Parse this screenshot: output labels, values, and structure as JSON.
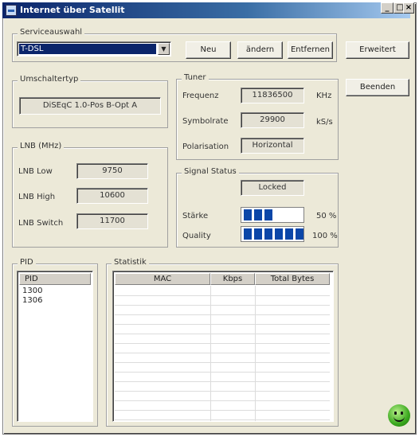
{
  "window": {
    "title": "Internet über Satellit",
    "min_label": "_",
    "max_label": "□",
    "close_label": "×"
  },
  "service": {
    "legend": "Serviceauswahl",
    "selected": "T-DSL",
    "new_label": "Neu",
    "change_label": "ändern",
    "remove_label": "Entfernen"
  },
  "buttons": {
    "advanced_label": "Erweitert",
    "exit_label": "Beenden"
  },
  "switch": {
    "legend": "Umschaltertyp",
    "value": "DiSEqC 1.0-Pos B-Opt A"
  },
  "tuner": {
    "legend": "Tuner",
    "frequency_label": "Frequenz",
    "frequency_value": "11836500",
    "frequency_unit": "KHz",
    "symbolrate_label": "Symbolrate",
    "symbolrate_value": "29900",
    "symbolrate_unit": "kS/s",
    "polarisation_label": "Polarisation",
    "polarisation_value": "Horizontal"
  },
  "lnb": {
    "legend": "LNB (MHz)",
    "low_label": "LNB Low",
    "low_value": "9750",
    "high_label": "LNB High",
    "high_value": "10600",
    "switch_label": "LNB Switch",
    "switch_value": "11700"
  },
  "signal": {
    "legend": "Signal Status",
    "status": "Locked",
    "strength_label": "Stärke",
    "strength_value": "50 %",
    "strength_pct": 50,
    "quality_label": "Quality",
    "quality_value": "100 %",
    "quality_pct": 100
  },
  "pid": {
    "legend": "PID",
    "header": "PID",
    "rows": [
      "1300",
      "1306"
    ]
  },
  "stats": {
    "legend": "Statistik",
    "headers": [
      "MAC",
      "Kbps",
      "Total Bytes"
    ]
  },
  "colors": {
    "title_bar": "#0a246a",
    "selection": "#0a246a",
    "signal_bar": "#0a46a8",
    "status_ok": "#3aa81e"
  },
  "icons": {
    "status": "smiley-icon",
    "app": "app-icon"
  }
}
